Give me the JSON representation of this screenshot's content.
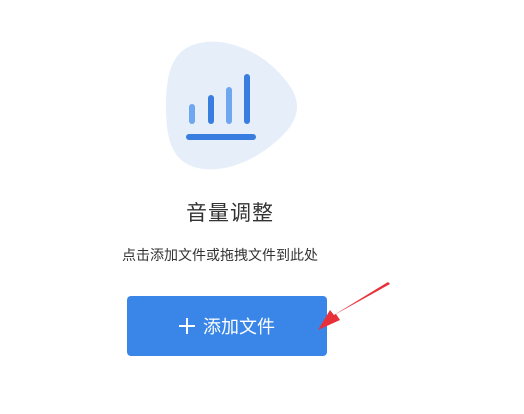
{
  "main": {
    "illustration_icon": "audio-level-bars-icon",
    "title": "音量调整",
    "hint": "点击添加文件或拖拽文件到此处",
    "add_button": {
      "label": "添加文件",
      "icon": "plus-icon"
    }
  },
  "colors": {
    "accent": "#3a86e8",
    "illustration_bg": "#e6eefa",
    "bar_light": "#6ea6f0",
    "bar_dark": "#3a7de0",
    "arrow": "#e8303a",
    "text": "#333333"
  }
}
